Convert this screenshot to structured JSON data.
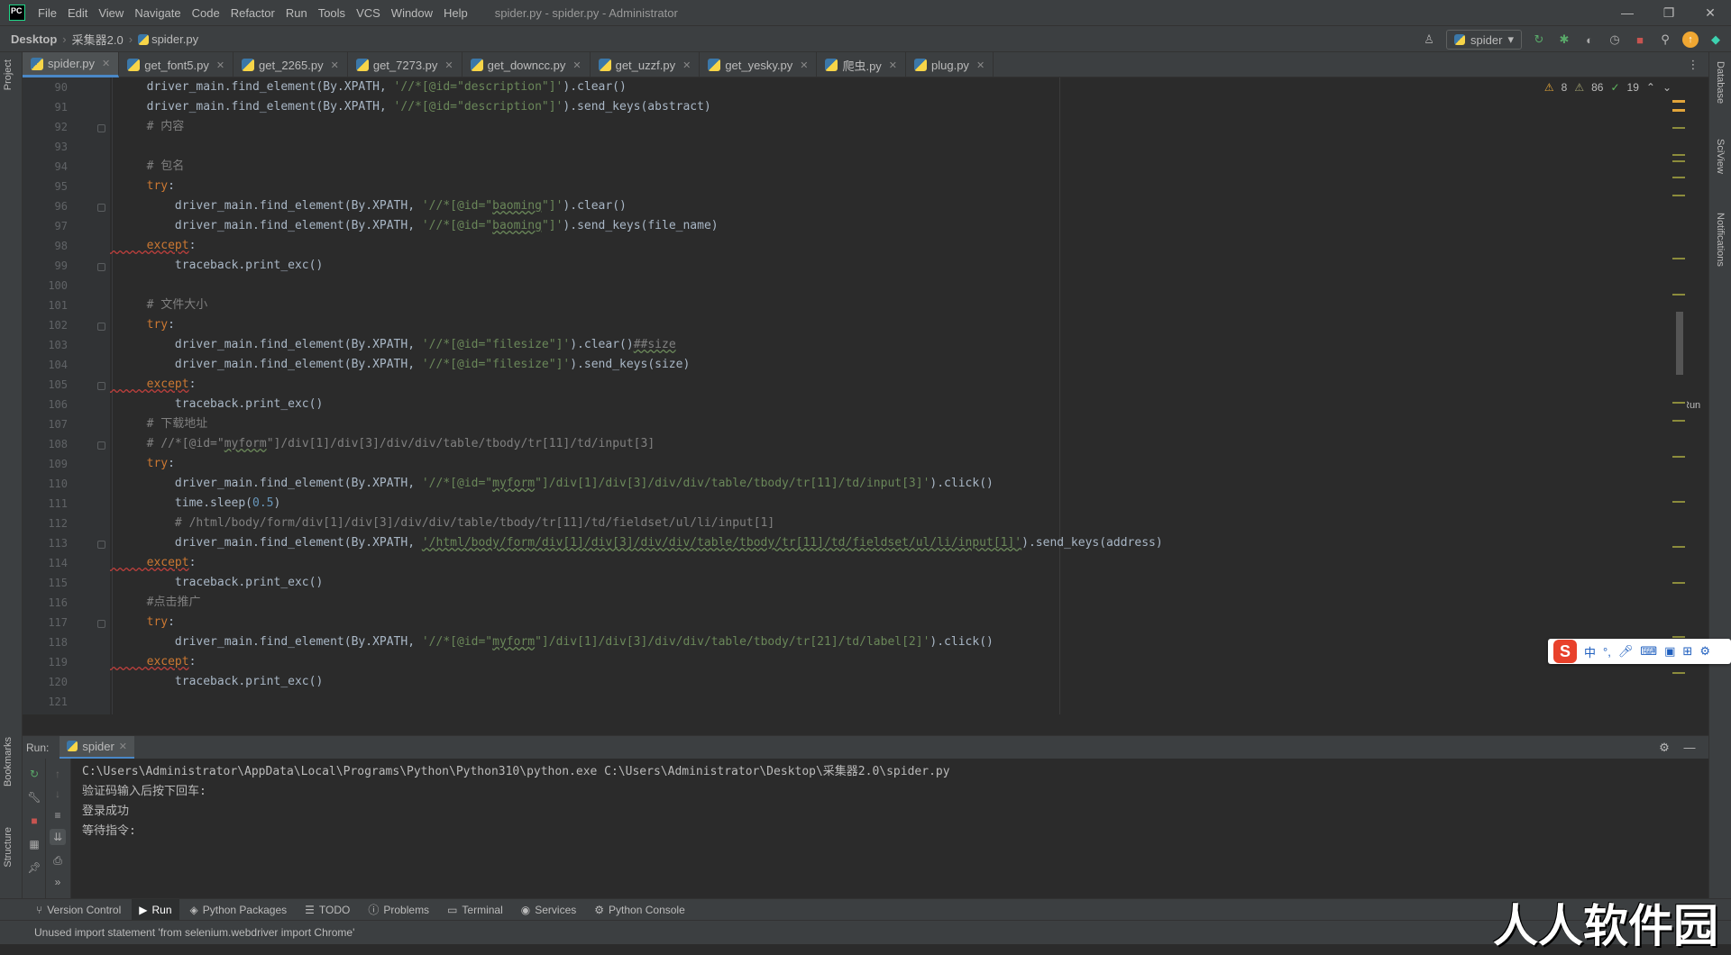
{
  "menubar": {
    "items": [
      "File",
      "Edit",
      "View",
      "Navigate",
      "Code",
      "Refactor",
      "Run",
      "Tools",
      "VCS",
      "Window",
      "Help"
    ],
    "title": "spider.py - spider.py - Administrator"
  },
  "navbar": {
    "crumb1": "Desktop",
    "crumb2": "采集器2.0",
    "crumb3": "spider.py",
    "run_config": "spider"
  },
  "tabs": [
    "spider.py",
    "get_font5.py",
    "get_2265.py",
    "get_7273.py",
    "get_downcc.py",
    "get_uzzf.py",
    "get_yesky.py",
    "爬虫.py",
    "plug.py"
  ],
  "left_tools": {
    "project": "Project",
    "bookmarks": "Bookmarks",
    "structure": "Structure"
  },
  "right_tools": {
    "database": "Database",
    "sciview": "SciView",
    "notifications": "Notifications",
    "run": "Run"
  },
  "inspections": {
    "warnings": "8",
    "weak_warnings": "86",
    "typos": "19"
  },
  "line_numbers": [
    "90",
    "91",
    "92",
    "93",
    "94",
    "95",
    "96",
    "97",
    "98",
    "99",
    "100",
    "101",
    "102",
    "103",
    "104",
    "105",
    "106",
    "107",
    "108",
    "109",
    "110",
    "111",
    "112",
    "113",
    "114",
    "115",
    "116",
    "117",
    "118",
    "119",
    "120",
    "121"
  ],
  "run_panel": {
    "label": "Run:",
    "tab": "spider",
    "console": [
      "C:\\Users\\Administrator\\AppData\\Local\\Programs\\Python\\Python310\\python.exe C:\\Users\\Administrator\\Desktop\\采集器2.0\\spider.py",
      "验证码输入后按下回车:",
      "登录成功",
      "等待指令:"
    ]
  },
  "toolwindows": [
    "Version Control",
    "Run",
    "Python Packages",
    "TODO",
    "Problems",
    "Terminal",
    "Services",
    "Python Console"
  ],
  "status": {
    "message": "Unused import statement 'from selenium.webdriver import Chrome'"
  },
  "ime": {
    "chars": [
      "中",
      "°,"
    ]
  },
  "watermark": "人人软件园",
  "colors": {
    "keyword": "#cc7832",
    "string": "#6a8759",
    "number": "#6897bb",
    "comment": "#808080",
    "accent": "#4a88c7",
    "background": "#2b2b2b"
  }
}
